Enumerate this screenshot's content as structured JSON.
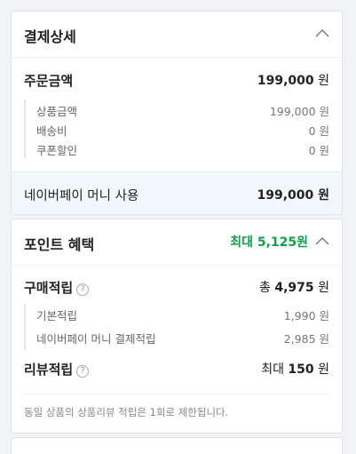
{
  "payment": {
    "title": "결제상세",
    "order_amount": {
      "label": "주문금액",
      "value": "199,000",
      "unit": "원"
    },
    "details": [
      {
        "label": "상품금액",
        "value": "199,000 원"
      },
      {
        "label": "배송비",
        "value": "0 원"
      },
      {
        "label": "쿠폰할인",
        "value": "0 원"
      }
    ],
    "naverpay": {
      "label": "네이버페이 머니 사용",
      "value": "199,000 원"
    }
  },
  "points": {
    "title": "포인트 혜택",
    "max_label": "최대 5,125원",
    "purchase": {
      "label": "구매적립",
      "help": "?",
      "prefix": "총",
      "value": "4,975",
      "unit": "원"
    },
    "purchase_details": [
      {
        "label": "기본적립",
        "value": "1,990 원"
      },
      {
        "label": "네이버페이 머니 결제적립",
        "value": "2,985 원"
      }
    ],
    "review": {
      "label": "리뷰적립",
      "help": "?",
      "prefix": "최대",
      "value": "150",
      "unit": "원"
    },
    "notice": "동일 상품의 상품리뷰 적립은 1회로 제한됩니다."
  },
  "icons": {
    "collapse": "chevron-up-icon",
    "help": "question-circle-icon"
  },
  "colors": {
    "accent_green": "#12a04b",
    "naverpay_bg": "#f2f8fe"
  }
}
